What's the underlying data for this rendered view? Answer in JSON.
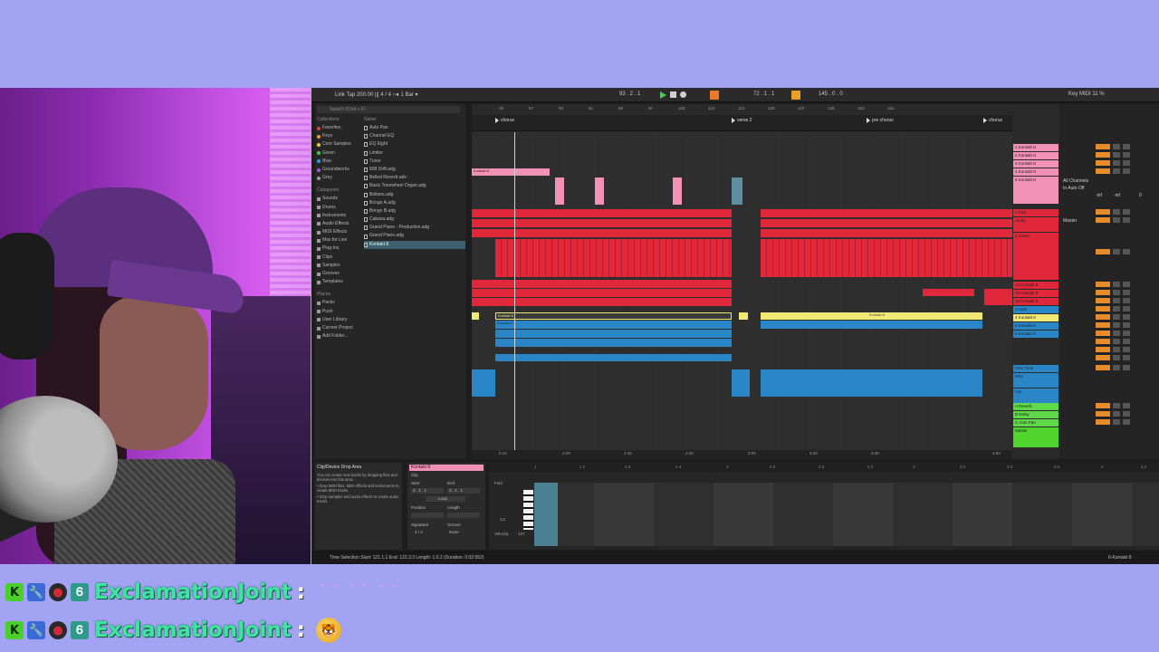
{
  "daw": {
    "transport": {
      "left": "Link  Tap  200.00  |||  4 / 4   ○●   1 Bar ▾",
      "position": "93 .  2 .  1",
      "loop_start": "72 .  1 .  1",
      "loop_len": "145 .  0 .  0",
      "right": "Key   MIDI   11 %"
    },
    "browser": {
      "search_placeholder": "Search (Cmd + F)",
      "collections_header": "Collections",
      "collections": [
        "Favorites",
        "Keys",
        "Core Samples",
        "Green",
        "Blue",
        "Groundworks",
        "Grey"
      ],
      "categories_header": "Categories",
      "categories": [
        "Sounds",
        "Drums",
        "Instruments",
        "Audio Effects",
        "MIDI Effects",
        "Max for Live",
        "Plug-Ins",
        "Clips",
        "Samples",
        "Grooves",
        "Templates"
      ],
      "places_header": "Places",
      "places": [
        "Packs",
        "Push",
        "User Library",
        "Current Project",
        "Add Folder..."
      ],
      "name_header": "Name",
      "files": [
        "Auto Pan",
        "Channel EQ",
        "EQ Eight",
        "Limiter",
        "Tuner",
        "808 Drift.adg",
        "Belled Reverb.adv",
        "Basic Tonewheel Organ.adg",
        "Boltons.adg",
        "Bongo A.adg",
        "Bongo B.adg",
        "Cabasa.adg",
        "Grand Piano - Production.adg",
        "Grand Piano.adg",
        "Kontakt 8"
      ]
    },
    "arrangement": {
      "ruler": [
        "49",
        "57",
        "65",
        "81",
        "89",
        "97",
        "105",
        "113",
        "121",
        "129",
        "137",
        "145",
        "153",
        "161"
      ],
      "locators": [
        "chorus",
        "verse 2",
        "pre chorus",
        "chorus"
      ],
      "times": [
        "0:10",
        "2:00",
        "2:30",
        "2:40",
        "3:00",
        "3:20",
        "3:40",
        "4:00"
      ],
      "clip_labels": {
        "pink": "Kontakt 8",
        "yellow_a": "Kontakt 8",
        "yellow_b": "Kontakt 8",
        "blue": "Kontakt 8"
      }
    },
    "tracks": [
      "1 Kontakt 8",
      "2 Kontakt 8",
      "3 Kontakt 8",
      "4 Kontakt 8",
      "5 Kontakt 8",
      "6 Kontakt 8",
      "1 Kick",
      "Audio",
      "3 Snare",
      "14 Kontakt 8",
      "15 Kontakt 8",
      "16 Kontakt 8",
      "3 Hats",
      "4 Kontakt 8",
      "5 Kontakt 8",
      "6 Kontakt 8",
      "Perc Time",
      "Perc",
      "Pad",
      "Vox",
      "A Reverb",
      "B Delay",
      "C Auto Pan",
      "Master"
    ],
    "mixer": {
      "io": [
        "All Channels",
        "In Auto Off",
        "Master"
      ],
      "values": [
        "-inf",
        "-inf",
        "0"
      ]
    },
    "info": {
      "title": "Clip/Device Drop Area",
      "lines": [
        "You can create new tracks by dropping files and devices into this area.",
        "• Drop MIDI files, MIDI effects and instruments to create MIDI tracks.",
        "• Drop samples and audio effects to create audio tracks."
      ]
    },
    "clip_panel": {
      "name": "Kontakt 8",
      "clip": "Clip",
      "start": "Start",
      "end": "End",
      "loop": "Loop",
      "position": "Position",
      "length": "Length",
      "signature": "Signature",
      "groove": "Groove",
      "sig_val": "4 / 4",
      "groove_val": "None",
      "start_val": "2 . 1 . 1",
      "end_val": "3 . 1 . 1"
    },
    "notes": {
      "ruler": [
        "1",
        "1.2",
        "1.3",
        "1.4",
        "2",
        "2.2",
        "2.3",
        "2.4",
        "3",
        "3.2",
        "3.3",
        "3.4",
        "4",
        "4.2"
      ],
      "fold": "Fold",
      "c4": "C4",
      "velocity": "Velocity",
      "velocity_val": "127"
    },
    "status": {
      "selection": "Time Selection   Start: 121.1.1   End: 122.3.3   Length: 1.0.2 (Duration: 0:02:052)",
      "right": "6-Kontakt 8"
    }
  },
  "chat": [
    {
      "user": "ExclamationJoint",
      "sep": ":",
      "emote": "＾＾  ＾＾  ＾＾"
    },
    {
      "user": "ExclamationJoint",
      "sep": ":",
      "emote": "🐯"
    }
  ],
  "badges": [
    "K",
    "🔧",
    "●",
    "Ꮾ"
  ],
  "colors": {
    "background": "#a3a3f3",
    "username": "#41e3a1",
    "red_clip": "#e0283a",
    "blue_clip": "#2b86c8",
    "yellow_clip": "#f2e874",
    "pink_clip": "#f191b4"
  }
}
